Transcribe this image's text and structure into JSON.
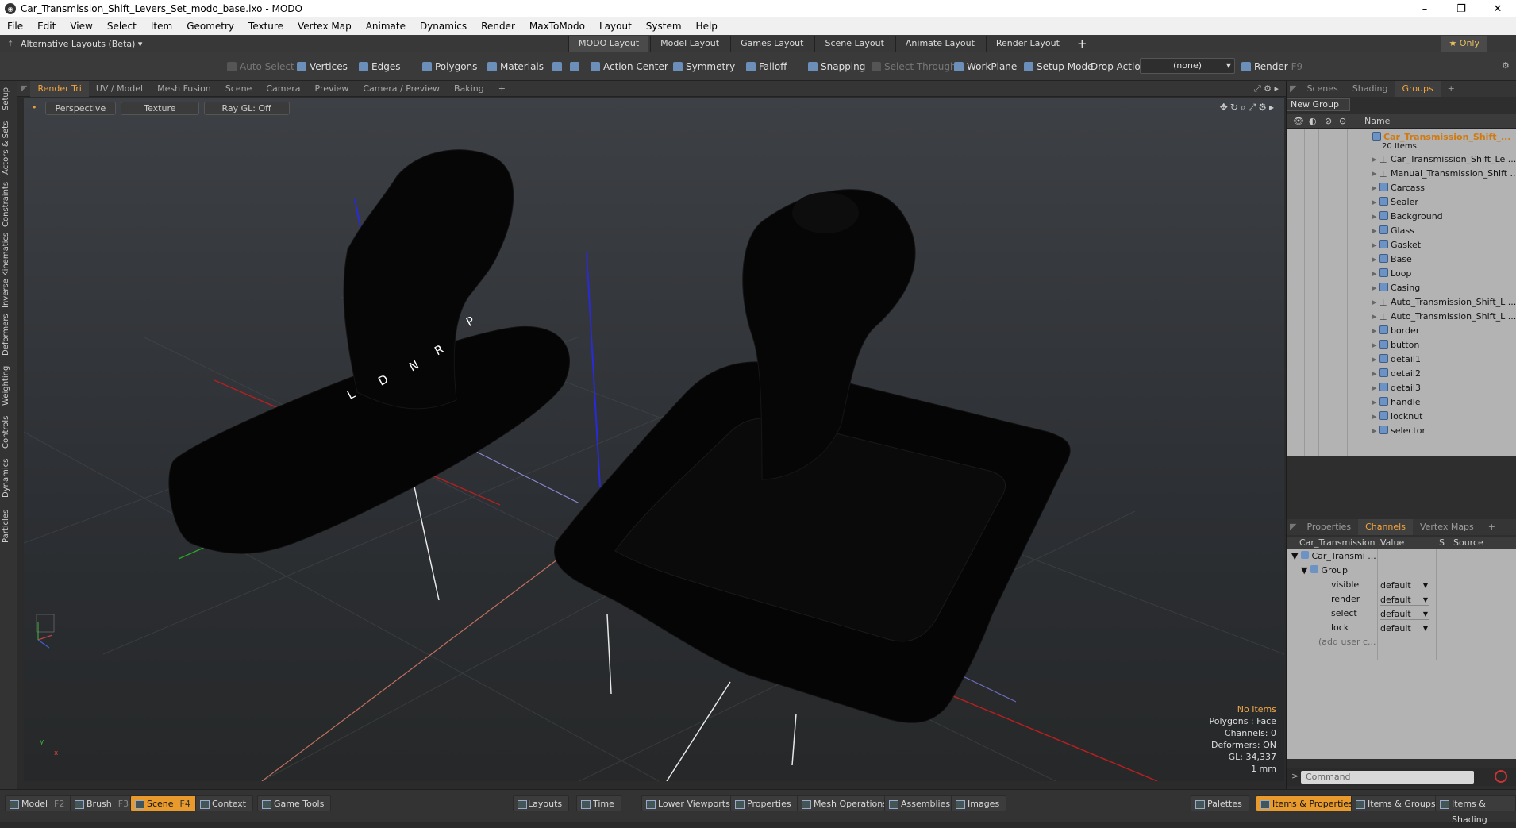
{
  "window": {
    "title": "Car_Transmission_Shift_Levers_Set_modo_base.lxo - MODO",
    "controls": [
      "–",
      "❐",
      "✕"
    ]
  },
  "menu": [
    "File",
    "Edit",
    "View",
    "Select",
    "Item",
    "Geometry",
    "Texture",
    "Vertex Map",
    "Animate",
    "Dynamics",
    "Render",
    "MaxToModo",
    "Layout",
    "System",
    "Help"
  ],
  "layoutbar": {
    "selector": "Alternative Layouts (Beta) ▾",
    "tabs": [
      "MODO Layout",
      "Model Layout",
      "Games Layout",
      "Scene Layout",
      "Animate Layout",
      "Render Layout"
    ],
    "add": "+",
    "only": "★ Only"
  },
  "toolbar": {
    "auto_select": "Auto Select",
    "vertices": "Vertices",
    "edges": "Edges",
    "polygons": "Polygons",
    "materials": "Materials",
    "action_center": "Action Center",
    "symmetry": "Symmetry",
    "falloff": "Falloff",
    "snapping": "Snapping",
    "select_through": "Select Through",
    "workplane": "WorkPlane",
    "setup_mode": "Setup Mode",
    "drop_action": "Drop Action",
    "drop_value": "(none)",
    "render": "Render",
    "render_key": "F9"
  },
  "left_rail": [
    "Setup",
    "Actors & Sets",
    "Constraints",
    "Inverse Kinematics",
    "Deformers",
    "Weighting",
    "Controls",
    "Dynamics",
    "Particles"
  ],
  "viewport_tabs": [
    "Render Tri",
    "UV / Model",
    "Mesh Fusion",
    "Scene",
    "Camera",
    "Preview",
    "Camera / Preview",
    "Baking",
    "+"
  ],
  "viewport": {
    "view": "Perspective",
    "shading": "Texture",
    "raygl": "Ray GL: Off",
    "gear_letters": [
      "P",
      "R",
      "N",
      "D",
      "L"
    ],
    "info": {
      "no_items": "No Items",
      "polygons": "Polygons : Face",
      "channels": "Channels: 0",
      "deformers": "Deformers: ON",
      "gl": "GL: 34,337",
      "unit": "1 mm"
    },
    "axis_x": "x",
    "axis_y": "y"
  },
  "right_tabs": [
    "Scenes",
    "Shading",
    "Groups",
    "+"
  ],
  "groups": {
    "new_group": "New Group",
    "name_header": "Name",
    "root": "Car_Transmission_Shift_...",
    "root_count": "20 Items",
    "items": [
      {
        "name": "Car_Transmission_Shift_Le ...",
        "type": "locator"
      },
      {
        "name": "Manual_Transmission_Shift ...",
        "type": "locator"
      },
      {
        "name": "Carcass",
        "type": "mesh"
      },
      {
        "name": "Sealer",
        "type": "mesh"
      },
      {
        "name": "Background",
        "type": "mesh"
      },
      {
        "name": "Glass",
        "type": "mesh"
      },
      {
        "name": "Gasket",
        "type": "mesh"
      },
      {
        "name": "Base",
        "type": "mesh"
      },
      {
        "name": "Loop",
        "type": "mesh"
      },
      {
        "name": "Casing",
        "type": "mesh"
      },
      {
        "name": "Auto_Transmission_Shift_L ...",
        "type": "locator"
      },
      {
        "name": "Auto_Transmission_Shift_L ...",
        "type": "locator"
      },
      {
        "name": "border",
        "type": "mesh"
      },
      {
        "name": "button",
        "type": "mesh"
      },
      {
        "name": "detail1",
        "type": "mesh"
      },
      {
        "name": "detail2",
        "type": "mesh"
      },
      {
        "name": "detail3",
        "type": "mesh"
      },
      {
        "name": "handle",
        "type": "mesh"
      },
      {
        "name": "locknut",
        "type": "mesh"
      },
      {
        "name": "selector",
        "type": "mesh"
      }
    ]
  },
  "props_tabs": [
    "Properties",
    "Channels",
    "Vertex Maps",
    "+"
  ],
  "channels": {
    "headers": [
      "Car_Transmission ...",
      "Value",
      "S",
      "Source"
    ],
    "root": "Car_Transmi ...",
    "group": "Group",
    "rows": [
      {
        "name": "visible",
        "value": "default"
      },
      {
        "name": "render",
        "value": "default"
      },
      {
        "name": "select",
        "value": "default"
      },
      {
        "name": "lock",
        "value": "default"
      }
    ],
    "add_user": "(add user c..."
  },
  "command_placeholder": "Command",
  "bottom": {
    "left": [
      {
        "label": "Model",
        "key": "F2"
      },
      {
        "label": "Brush",
        "key": "F3"
      },
      {
        "label": "Scene",
        "key": "F4"
      },
      {
        "label": "Context",
        "key": ""
      },
      {
        "label": "Game Tools",
        "key": ""
      }
    ],
    "center": [
      "Layouts",
      "Time",
      "Lower Viewports",
      "Properties",
      "Mesh Operations",
      "Assemblies",
      "Images"
    ],
    "right": [
      "Palettes",
      "Items & Properties",
      "Items & Groups",
      "Items & Shading"
    ]
  },
  "colors": {
    "accent": "#f3a43d",
    "active_button": "#e89a2c"
  }
}
